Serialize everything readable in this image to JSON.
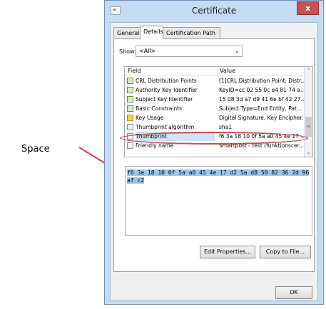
{
  "window": {
    "title": "Certificate",
    "close_label": "x"
  },
  "tabs": [
    {
      "label": "General"
    },
    {
      "label": "Details"
    },
    {
      "label": "Certification Path"
    }
  ],
  "show": {
    "label": "Show:",
    "value": "<All>"
  },
  "list": {
    "header_field": "Field",
    "header_value": "Value",
    "rows": [
      {
        "field": "CRL Distribution Points",
        "value": "[1]CRL Distribution Point: Distr...",
        "icon": "cert-icon"
      },
      {
        "field": "Authority Key Identifier",
        "value": "KeyID=cc 02 55 0c e4 81 74 a...",
        "icon": "cert-icon"
      },
      {
        "field": "Subject Key Identifier",
        "value": "15 08 3d a7 d9 41 6e bf 42 27...",
        "icon": "cert-icon"
      },
      {
        "field": "Basic Constraints",
        "value": "Subject Type=End Entity, Pat...",
        "icon": "cert-icon"
      },
      {
        "field": "Key Usage",
        "value": "Digital Signature, Key Encipher...",
        "icon": "warning-icon"
      },
      {
        "field": "Thumbprint algorithm",
        "value": "sha1",
        "icon": "document-icon"
      },
      {
        "field": "Thumbprint",
        "value": "f6 3a 18 10 0f 5a a0 45 4e 17 ...",
        "icon": "document-icon"
      },
      {
        "field": "Friendly name",
        "value": "Smartpost - test (funktionscer...",
        "icon": "document-icon"
      }
    ]
  },
  "value_box": {
    "text": "f6 3a 18 10 0f 5a a0 45 4e 17 d2 5a d8 50 82 36 2d 96 af c2"
  },
  "buttons": {
    "edit_properties": "Edit Properties...",
    "copy_to_file": "Copy to File...",
    "ok": "OK"
  },
  "annotation": {
    "label": "Space",
    "color": "#e23b3b"
  }
}
